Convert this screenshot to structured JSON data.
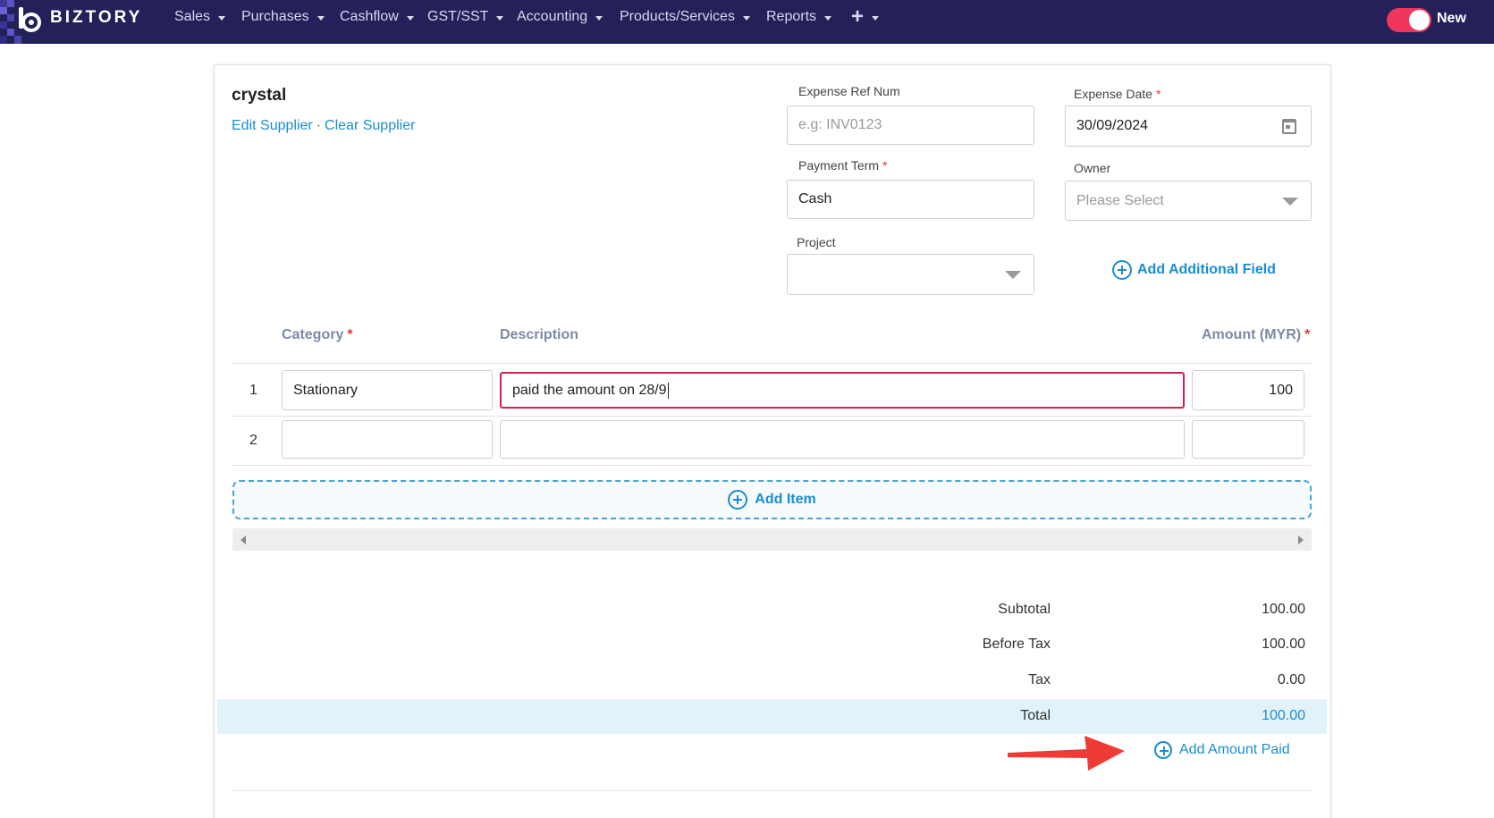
{
  "nav": {
    "brand": "BIZTORY",
    "items": [
      {
        "label": "Sales"
      },
      {
        "label": "Purchases"
      },
      {
        "label": "Cashflow"
      },
      {
        "label": "GST/SST"
      },
      {
        "label": "Accounting"
      },
      {
        "label": "Products/Services"
      },
      {
        "label": "Reports"
      }
    ],
    "plus": "+",
    "toggle_label": "New"
  },
  "supplier": {
    "name": "crystal",
    "edit_link": "Edit Supplier",
    "separator": "·",
    "clear_link": "Clear Supplier"
  },
  "fields": {
    "expense_ref": {
      "label": "Expense Ref Num",
      "value": "",
      "placeholder": "e.g: INV0123"
    },
    "expense_date": {
      "label": "Expense Date",
      "value": "30/09/2024",
      "required": "*"
    },
    "payment_term": {
      "label": "Payment Term",
      "value": "Cash",
      "required": "*"
    },
    "owner": {
      "label": "Owner",
      "placeholder": "Please Select"
    },
    "project": {
      "label": "Project",
      "value": ""
    },
    "add_additional_field": "Add Additional Field"
  },
  "table": {
    "headers": {
      "category": "Category",
      "description": "Description",
      "amount": "Amount (MYR)",
      "required": "*"
    },
    "rows": [
      {
        "num": "1",
        "category": "Stationary",
        "description": "paid the amount on 28/9",
        "amount": "100"
      },
      {
        "num": "2",
        "category": "",
        "description": "",
        "amount": ""
      }
    ],
    "add_item": "Add Item"
  },
  "totals": {
    "subtotal_label": "Subtotal",
    "subtotal": "100.00",
    "before_tax_label": "Before Tax",
    "before_tax": "100.00",
    "tax_label": "Tax",
    "tax": "0.00",
    "total_label": "Total",
    "total": "100.00",
    "add_amount_paid": "Add Amount Paid"
  },
  "colors": {
    "nav_bg": "#23205a",
    "accent": "#1a8dd0",
    "toggle": "#f0365d",
    "required": "#e4363a",
    "annotation_arrow": "#ee3b35"
  }
}
